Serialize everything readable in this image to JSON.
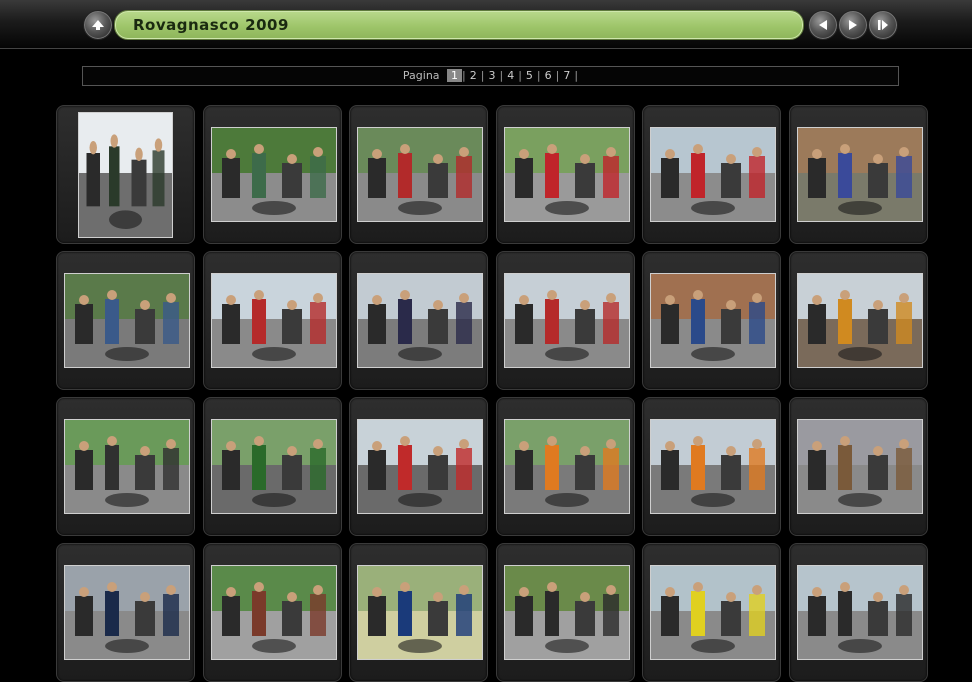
{
  "header": {
    "title": "Rovagnasco 2009",
    "buttons": [
      {
        "name": "up-button",
        "icon": "arrow-up-icon"
      },
      {
        "name": "previous-button",
        "icon": "arrow-left-icon"
      },
      {
        "name": "next-button",
        "icon": "arrow-right-icon"
      },
      {
        "name": "slideshow-button",
        "icon": "slideshow-icon"
      }
    ]
  },
  "pager": {
    "label": "Pagina",
    "pages": [
      "1",
      "2",
      "3",
      "4",
      "5",
      "6",
      "7"
    ],
    "current": "1",
    "separator": "|"
  },
  "gallery": {
    "thumbnails": [
      {
        "orientation": "portrait",
        "sky": "#e8ecef",
        "ground": "#6e6e6e",
        "accent": "#2a3a2a"
      },
      {
        "orientation": "landscape",
        "sky": "#4d7a3a",
        "ground": "#8c8c8c",
        "accent": "#3d6b4a"
      },
      {
        "orientation": "landscape",
        "sky": "#6a8a5a",
        "ground": "#8a8a8a",
        "accent": "#b22a2a"
      },
      {
        "orientation": "landscape",
        "sky": "#7aa05f",
        "ground": "#9a9a9a",
        "accent": "#c0242a"
      },
      {
        "orientation": "landscape",
        "sky": "#b7c6d0",
        "ground": "#8c8c8c",
        "accent": "#c0242a"
      },
      {
        "orientation": "landscape",
        "sky": "#9c7a5a",
        "ground": "#7a7a6a",
        "accent": "#3a4a9a"
      },
      {
        "orientation": "landscape",
        "sky": "#5a7a4a",
        "ground": "#7a7a7a",
        "accent": "#3a5a8a"
      },
      {
        "orientation": "landscape",
        "sky": "#c9d4dc",
        "ground": "#8a8a8a",
        "accent": "#b52a2a"
      },
      {
        "orientation": "landscape",
        "sky": "#c2cbd2",
        "ground": "#7c7c7c",
        "accent": "#2a2a4a"
      },
      {
        "orientation": "landscape",
        "sky": "#c6cfd6",
        "ground": "#8a8a8a",
        "accent": "#b52a2a"
      },
      {
        "orientation": "landscape",
        "sky": "#a07050",
        "ground": "#8a8a8a",
        "accent": "#2a4a8a"
      },
      {
        "orientation": "landscape",
        "sky": "#c8d0d6",
        "ground": "#7a6a5a",
        "accent": "#d08a20"
      },
      {
        "orientation": "landscape",
        "sky": "#6a9a5a",
        "ground": "#8a8a8a",
        "accent": "#303030"
      },
      {
        "orientation": "landscape",
        "sky": "#7aa06a",
        "ground": "#6a6a6a",
        "accent": "#2a6a2a"
      },
      {
        "orientation": "landscape",
        "sky": "#c8d2d8",
        "ground": "#6a6a6a",
        "accent": "#c02a2a"
      },
      {
        "orientation": "landscape",
        "sky": "#7aa06a",
        "ground": "#7a7a7a",
        "accent": "#e07a20"
      },
      {
        "orientation": "landscape",
        "sky": "#c2ccd4",
        "ground": "#7a7a7a",
        "accent": "#e07a20"
      },
      {
        "orientation": "landscape",
        "sky": "#9a9aa0",
        "ground": "#8a8a8a",
        "accent": "#7a5a3a"
      },
      {
        "orientation": "landscape",
        "sky": "#9aa2aa",
        "ground": "#8a8a8a",
        "accent": "#1a2a4a"
      },
      {
        "orientation": "landscape",
        "sky": "#5a8a4a",
        "ground": "#a0a0a0",
        "accent": "#7a3a2a"
      },
      {
        "orientation": "landscape",
        "sky": "#9ab07a",
        "ground": "#cfcfa0",
        "accent": "#1a3a7a"
      },
      {
        "orientation": "landscape",
        "sky": "#6a8a4a",
        "ground": "#a0a0a0",
        "accent": "#2a2a2a"
      },
      {
        "orientation": "landscape",
        "sky": "#b2c2ca",
        "ground": "#8a8a8a",
        "accent": "#e0d020"
      },
      {
        "orientation": "landscape",
        "sky": "#b6c4cc",
        "ground": "#8a8a8a",
        "accent": "#2a2a2a"
      }
    ]
  }
}
